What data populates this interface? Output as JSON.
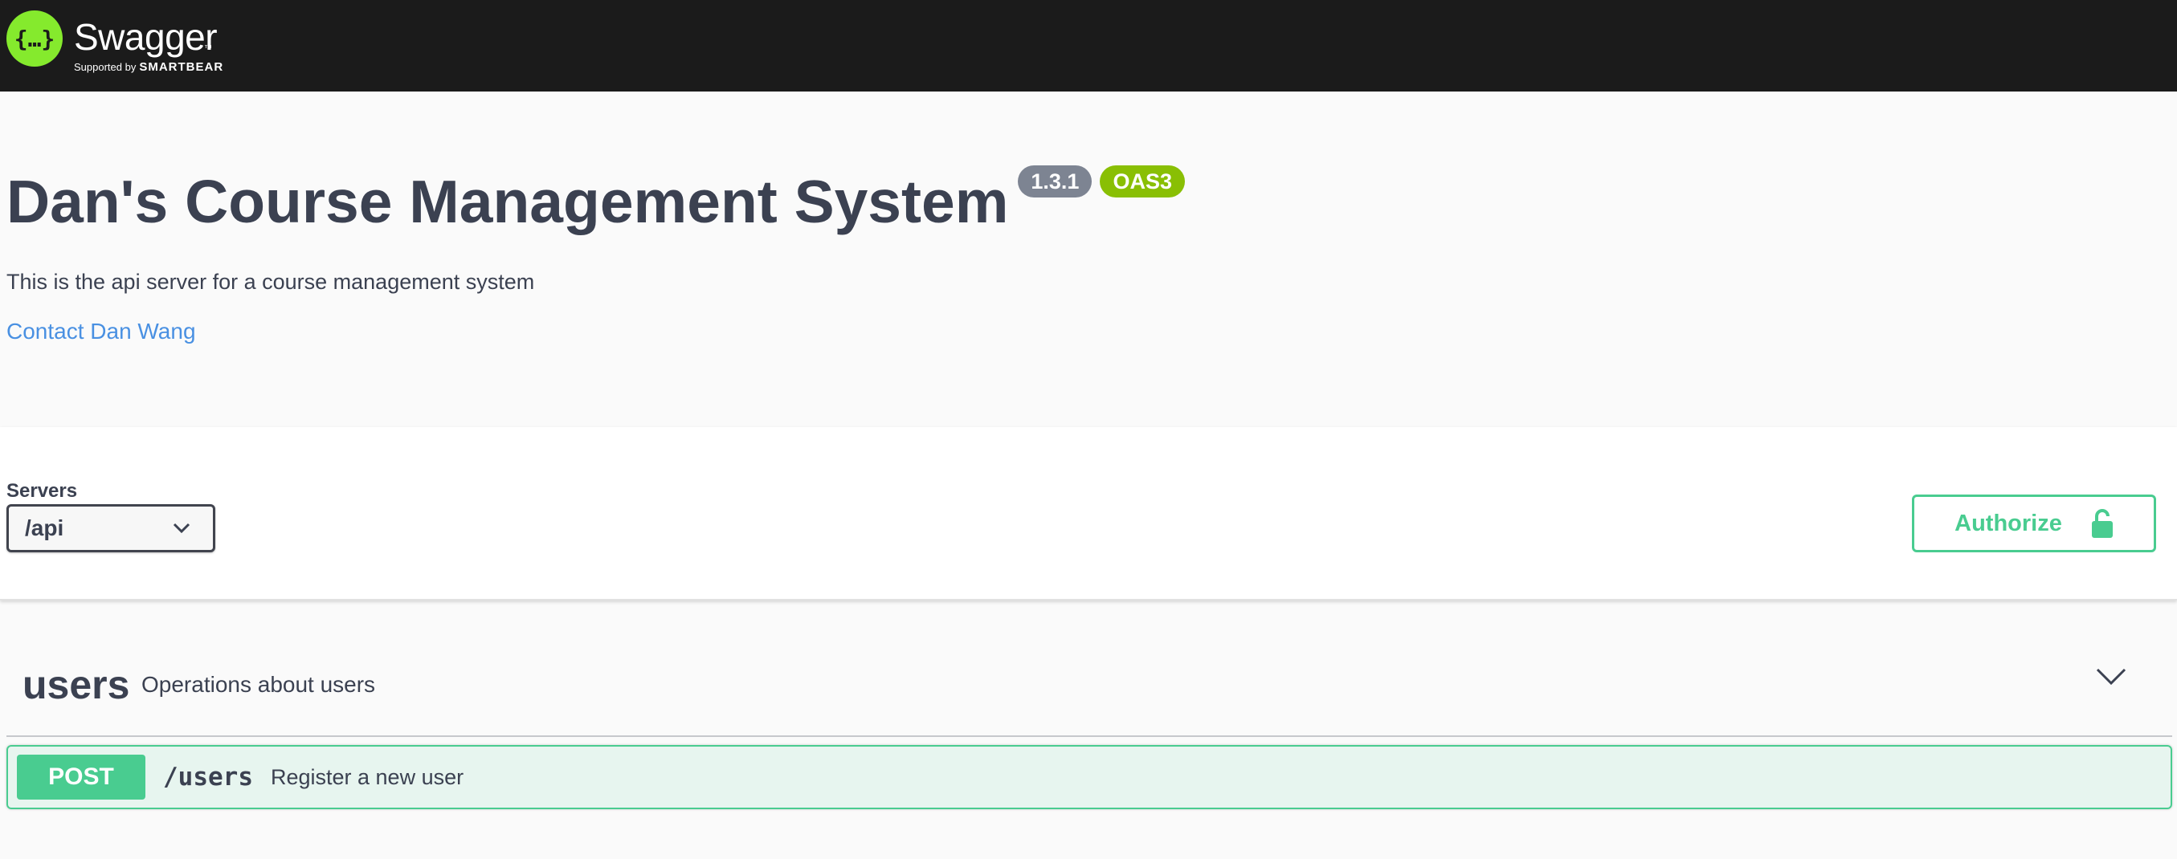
{
  "topbar": {
    "brand_name": "Swagger",
    "brand_tm": "™",
    "supported_by": "Supported by",
    "company": "SMARTBEAR",
    "logo_icon": "swagger-logo-icon",
    "logo_color": "#85ea2d"
  },
  "info": {
    "title": "Dan's Course Management System",
    "version": "1.3.1",
    "oas": "OAS3",
    "description": "This is the api server for a course management system",
    "contact": "Contact Dan Wang"
  },
  "scheme": {
    "servers_label": "Servers",
    "selected_server": "/api",
    "authorize_label": "Authorize",
    "authorize_icon": "unlock-icon"
  },
  "tags": [
    {
      "name": "users",
      "description": "Operations about users",
      "expanded": true,
      "operations": [
        {
          "method": "POST",
          "path": "/users",
          "summary": "Register a new user"
        }
      ]
    }
  ],
  "colors": {
    "post": "#49cc90",
    "topbar": "#1b1b1b",
    "link": "#4990e2",
    "version_badge": "#7d8492",
    "oas_badge": "#89bf04"
  }
}
